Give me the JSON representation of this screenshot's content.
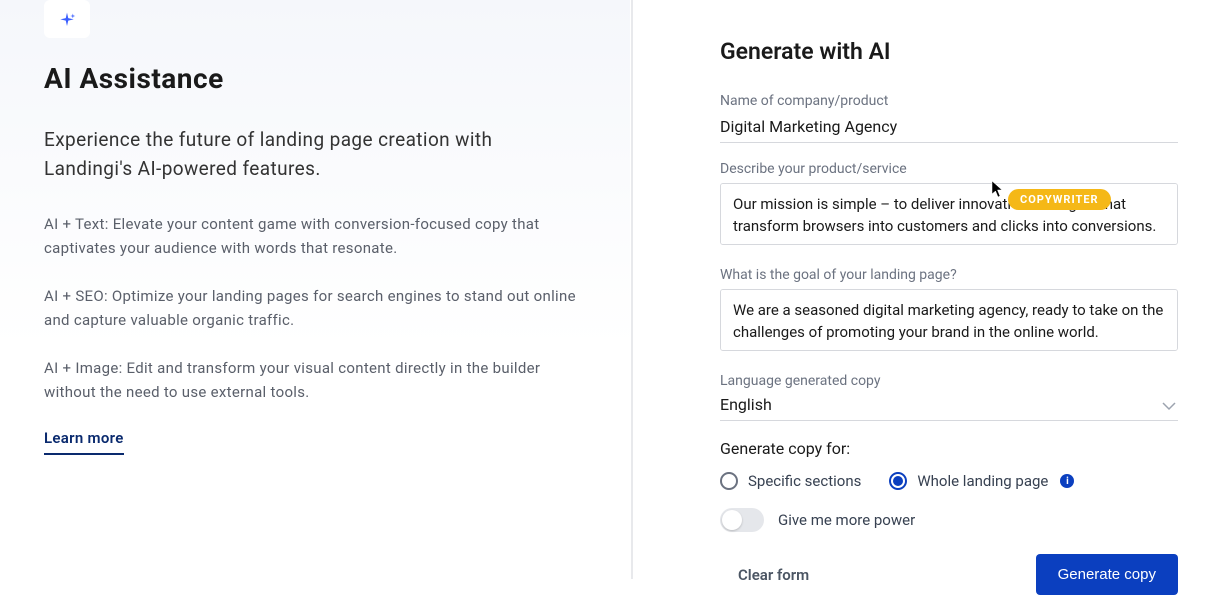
{
  "left": {
    "title": "AI Assistance",
    "intro": "Experience the future of landing page creation with Landingi's AI-powered features.",
    "body1": "AI + Text: Elevate your content game with conversion-focused copy that captivates your audience with words that resonate.",
    "body2": "AI + SEO: Optimize your landing pages for search engines to stand out online and capture valuable organic traffic.",
    "body3": "AI + Image: Edit and transform your visual content directly in the builder without the need to use external tools.",
    "learn_more": "Learn more"
  },
  "right": {
    "title": "Generate with AI",
    "company_label": "Name of company/product",
    "company_value": "Digital Marketing Agency",
    "describe_label": "Describe your product/service",
    "describe_value": "Our mission is simple – to deliver innovative strategies that transform browsers into customers and clicks into conversions.",
    "goal_label": "What is the goal of your landing page?",
    "goal_value": "We are a seasoned digital marketing agency, ready to take on the challenges of promoting your brand in the online world.",
    "lang_label": "Language generated copy",
    "lang_value": "English",
    "gen_for_label": "Generate copy for:",
    "radio_specific": "Specific sections",
    "radio_whole": "Whole landing page",
    "toggle_label": "Give me more power",
    "clear_form": "Clear form",
    "generate_btn": "Generate copy"
  },
  "badge": "COPYWRITER"
}
